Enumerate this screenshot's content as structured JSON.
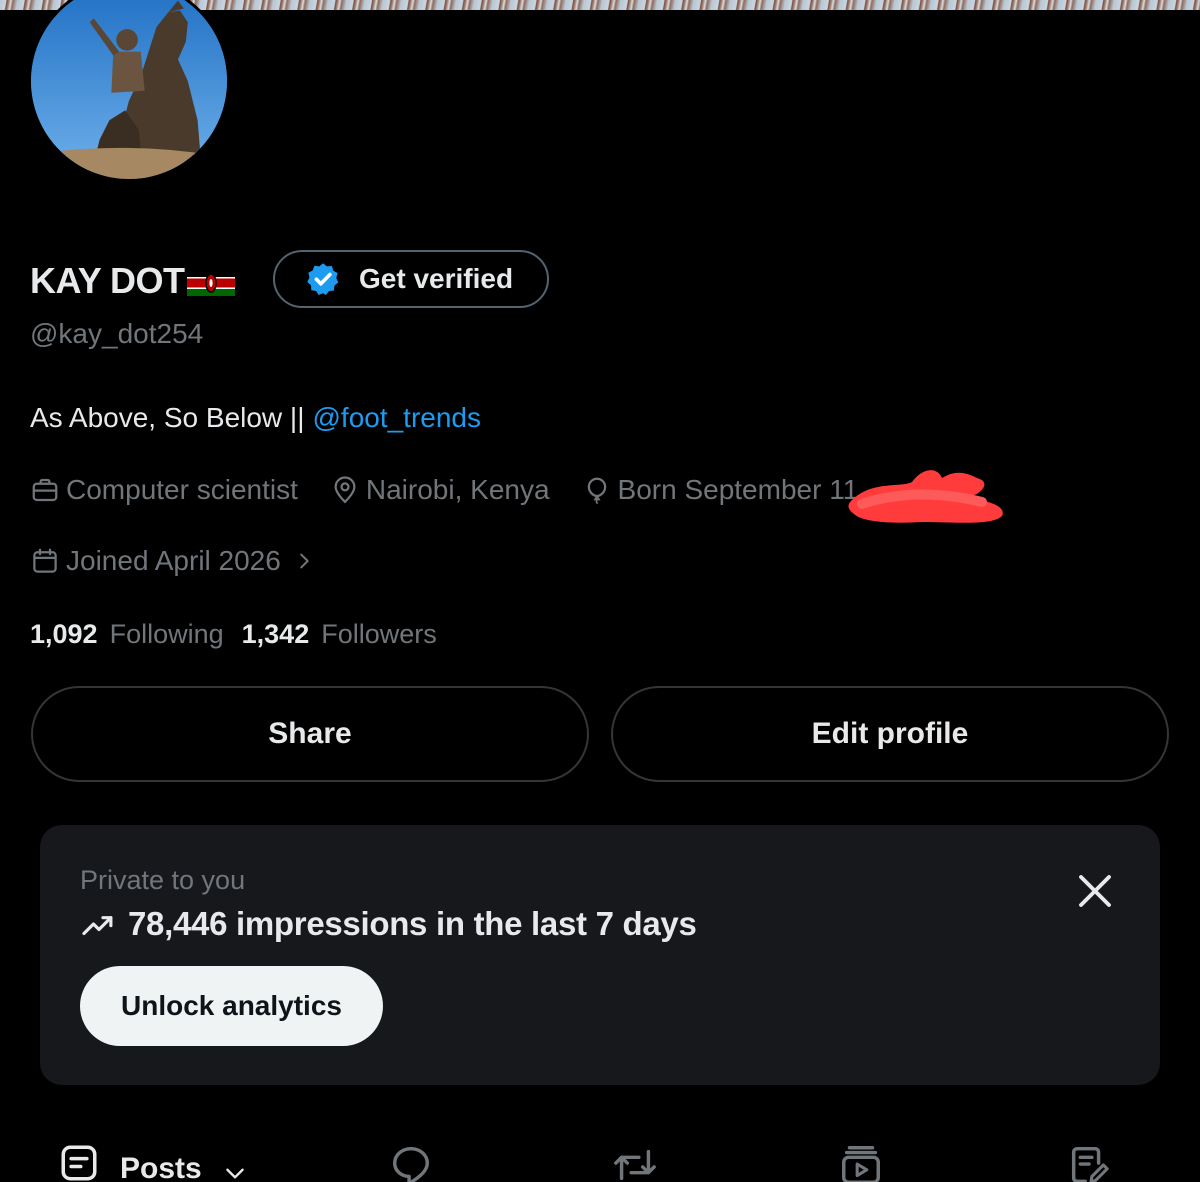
{
  "profile": {
    "display_name": "KAY DOT",
    "flag_icon": "kenya-flag-icon",
    "handle": "@kay_dot254",
    "get_verified_label": "Get verified",
    "bio_text": "As Above, So Below ||",
    "bio_mention": "@foot_trends",
    "profession": "Computer scientist",
    "location": "Nairobi, Kenya",
    "birth": "Born September 11",
    "joined": "Joined April 2026"
  },
  "stats": {
    "following_count": "1,092",
    "following_label": "Following",
    "followers_count": "1,342",
    "followers_label": "Followers"
  },
  "actions": {
    "share_label": "Share",
    "edit_profile_label": "Edit profile"
  },
  "analytics": {
    "private_label": "Private to you",
    "impressions_text": "78,446 impressions in the last 7 days",
    "unlock_label": "Unlock analytics"
  },
  "tabs": {
    "posts_label": "Posts",
    "icons": [
      "posts-icon",
      "replies-icon",
      "reposts-icon",
      "media-icon",
      "articles-icon"
    ]
  },
  "colors": {
    "background": "#000000",
    "text_primary": "#e7e9ea",
    "text_secondary": "#71767b",
    "accent_blue": "#1d9bf0",
    "card_background": "#16181c",
    "redaction": "#ff3b3b"
  }
}
